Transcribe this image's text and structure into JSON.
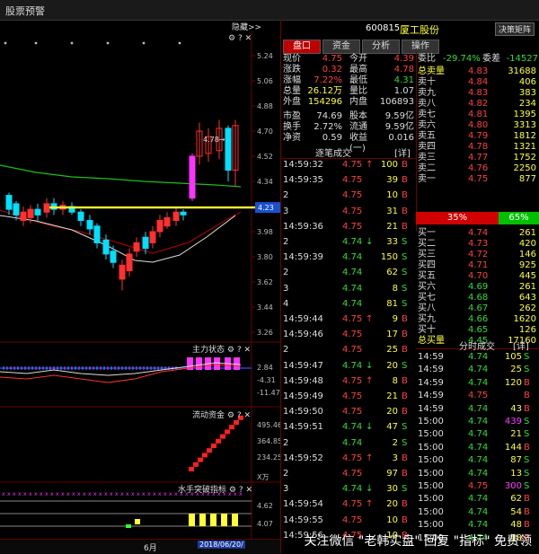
{
  "window": {
    "title": "股票预警"
  },
  "toolbar": {
    "hide_label": "隐藏>>"
  },
  "stock": {
    "code": "600815",
    "name": "厦工股份",
    "decision_btn": "决策矩阵"
  },
  "tabs": [
    {
      "label": "盘口"
    },
    {
      "label": "资金"
    },
    {
      "label": "分析"
    },
    {
      "label": "操作"
    }
  ],
  "quote_left": [
    {
      "k1": "现价",
      "v1": "4.75",
      "k2": "今开",
      "v2": "4.39"
    },
    {
      "k1": "涨跌",
      "v1": "0.32",
      "k2": "最高",
      "v2": "4.78"
    },
    {
      "k1": "涨幅",
      "v1": "7.22%",
      "k2": "最低",
      "v2": "4.31"
    },
    {
      "k1": "总量",
      "v1": "26.12万",
      "k2": "量比",
      "v2": "1.07"
    },
    {
      "k1": "外盘",
      "v1": "154296",
      "k2": "内盘",
      "v2": "106893"
    },
    {
      "k1": "市盈",
      "v1": "74.69",
      "k2": "股本",
      "v2": "9.59亿"
    },
    {
      "k1": "换手",
      "v1": "2.72%",
      "k2": "流通",
      "v2": "9.59亿"
    },
    {
      "k1": "净资",
      "v1": "0.59",
      "k2": "收益(一)",
      "v2": "0.016"
    }
  ],
  "commission": {
    "label1": "委比",
    "ratio": "-29.74%",
    "label2": "委差",
    "diff": "-14527"
  },
  "sell_orders": [
    {
      "label": "总卖量",
      "price": "4.83",
      "vol": "31688"
    },
    {
      "label": "卖十",
      "price": "4.84",
      "vol": "406"
    },
    {
      "label": "卖九",
      "price": "4.83",
      "vol": "383"
    },
    {
      "label": "卖八",
      "price": "4.82",
      "vol": "234"
    },
    {
      "label": "卖七",
      "price": "4.81",
      "vol": "1395"
    },
    {
      "label": "卖六",
      "price": "4.80",
      "vol": "3313"
    },
    {
      "label": "卖五",
      "price": "4.79",
      "vol": "1812"
    },
    {
      "label": "卖四",
      "price": "4.78",
      "vol": "1321"
    },
    {
      "label": "卖三",
      "price": "4.77",
      "vol": "1752"
    },
    {
      "label": "卖二",
      "price": "4.76",
      "vol": "2250"
    },
    {
      "label": "卖一",
      "price": "4.75",
      "vol": "877"
    }
  ],
  "ratio_bar": {
    "buy": "35%",
    "sell": "65%"
  },
  "buy_orders": [
    {
      "label": "买一",
      "price": "4.74",
      "vol": "261"
    },
    {
      "label": "买二",
      "price": "4.73",
      "vol": "420"
    },
    {
      "label": "买三",
      "price": "4.72",
      "vol": "146"
    },
    {
      "label": "买四",
      "price": "4.71",
      "vol": "925"
    },
    {
      "label": "买五",
      "price": "4.70",
      "vol": "445"
    },
    {
      "label": "买六",
      "price": "4.69",
      "vol": "261"
    },
    {
      "label": "买七",
      "price": "4.68",
      "vol": "643"
    },
    {
      "label": "买八",
      "price": "4.67",
      "vol": "262"
    },
    {
      "label": "买九",
      "price": "4.66",
      "vol": "1620"
    },
    {
      "label": "买十",
      "price": "4.65",
      "vol": "126"
    },
    {
      "label": "总买量",
      "price": "4.45",
      "vol": "17160"
    }
  ],
  "trades_title": "逐笔成交",
  "trades_btn": "[详]",
  "trades": [
    {
      "t": "14:59:32",
      "p": "4.75",
      "a": "↑",
      "v": "100",
      "s": "B"
    },
    {
      "t": "14:59:35",
      "p": "4.75",
      "a": "",
      "v": "39",
      "s": "B"
    },
    {
      "t": "2",
      "p": "4.75",
      "a": "",
      "v": "10",
      "s": "B"
    },
    {
      "t": "3",
      "p": "4.75",
      "a": "",
      "v": "31",
      "s": "B"
    },
    {
      "t": "14:59:36",
      "p": "4.75",
      "a": "",
      "v": "21",
      "s": "B"
    },
    {
      "t": "2",
      "p": "4.74",
      "a": "↓",
      "v": "33",
      "s": "S"
    },
    {
      "t": "14:59:39",
      "p": "4.74",
      "a": "",
      "v": "150",
      "s": "S"
    },
    {
      "t": "2",
      "p": "4.74",
      "a": "",
      "v": "62",
      "s": "S"
    },
    {
      "t": "3",
      "p": "4.74",
      "a": "",
      "v": "8",
      "s": "S"
    },
    {
      "t": "4",
      "p": "4.74",
      "a": "",
      "v": "81",
      "s": "S"
    },
    {
      "t": "14:59:44",
      "p": "4.75",
      "a": "↑",
      "v": "9",
      "s": "B"
    },
    {
      "t": "14:59:46",
      "p": "4.75",
      "a": "",
      "v": "17",
      "s": "B"
    },
    {
      "t": "2",
      "p": "4.75",
      "a": "",
      "v": "25",
      "s": "B"
    },
    {
      "t": "14:59:47",
      "p": "4.74",
      "a": "↓",
      "v": "20",
      "s": "S"
    },
    {
      "t": "14:59:48",
      "p": "4.75",
      "a": "↑",
      "v": "8",
      "s": "B"
    },
    {
      "t": "14:59:49",
      "p": "4.75",
      "a": "",
      "v": "21",
      "s": "B"
    },
    {
      "t": "14:59:50",
      "p": "4.75",
      "a": "",
      "v": "20",
      "s": "B"
    },
    {
      "t": "14:59:51",
      "p": "4.74",
      "a": "↓",
      "v": "47",
      "s": "S"
    },
    {
      "t": "2",
      "p": "4.74",
      "a": "",
      "v": "2",
      "s": "S"
    },
    {
      "t": "14:59:52",
      "p": "4.75",
      "a": "↑",
      "v": "3",
      "s": "B"
    },
    {
      "t": "2",
      "p": "4.75",
      "a": "",
      "v": "97",
      "s": "B"
    },
    {
      "t": "3",
      "p": "4.74",
      "a": "↓",
      "v": "30",
      "s": "S"
    },
    {
      "t": "14:59:54",
      "p": "4.75",
      "a": "↑",
      "v": "20",
      "s": "B"
    },
    {
      "t": "14:59:55",
      "p": "4.75",
      "a": "",
      "v": "10",
      "s": "B"
    },
    {
      "t": "14:59:56",
      "p": "4.75",
      "a": "",
      "v": "10",
      "s": "B"
    }
  ],
  "ticks_title": "分时成交",
  "ticks_btn": "[详]",
  "ticks": [
    {
      "t": "14:59",
      "p": "4.74",
      "v": "105",
      "s": "S"
    },
    {
      "t": "14:59",
      "p": "4.74",
      "v": "25",
      "s": "S"
    },
    {
      "t": "14:59",
      "p": "4.74",
      "v": "120",
      "s": "B"
    },
    {
      "t": "14:59",
      "p": "4.75",
      "v": "",
      "s": "B"
    },
    {
      "t": "14:59",
      "p": "4.74",
      "v": "43",
      "s": "B"
    },
    {
      "t": "15:00",
      "p": "4.74",
      "v": "439",
      "s": "S"
    },
    {
      "t": "15:00",
      "p": "4.74",
      "v": "21",
      "s": "S"
    },
    {
      "t": "15:00",
      "p": "4.74",
      "v": "144",
      "s": "B"
    },
    {
      "t": "15:00",
      "p": "4.74",
      "v": "87",
      "s": "S"
    },
    {
      "t": "15:00",
      "p": "4.74",
      "v": "13",
      "s": "S"
    },
    {
      "t": "15:00",
      "p": "4.75",
      "v": "300",
      "s": "S"
    },
    {
      "t": "15:00",
      "p": "4.74",
      "v": "62",
      "s": "B"
    },
    {
      "t": "15:00",
      "p": "4.74",
      "v": "54",
      "s": "B"
    },
    {
      "t": "15:00",
      "p": "4.74",
      "v": "48",
      "s": "B"
    },
    {
      "t": "15:00",
      "p": "4.74",
      "v": "18",
      "s": "B"
    }
  ],
  "kline": {
    "y_ticks": [
      "5.24",
      "5.06",
      "4.88",
      "4.70",
      "4.52",
      "4.34",
      "4.16",
      "3.98",
      "3.80",
      "3.62",
      "3.44",
      "3.26"
    ],
    "current_price_label": "4.23",
    "high_annotation": "4.78→",
    "month_label": "6月",
    "date_label": "2018/06/20/"
  },
  "indicators": [
    {
      "name": "主力状态",
      "ticks": [
        "2.84",
        "-4.31",
        "-11.47"
      ]
    },
    {
      "name": "流动资金",
      "ticks": [
        "495.46",
        "364.85",
        "234.25"
      ],
      "unit": "X万"
    },
    {
      "name": "水手突破指标",
      "ticks": [
        "4.62",
        "4.07"
      ]
    }
  ],
  "watermark": "关注微信 \"老韩实盘\" 回复 \"指标\" 免费领"
}
